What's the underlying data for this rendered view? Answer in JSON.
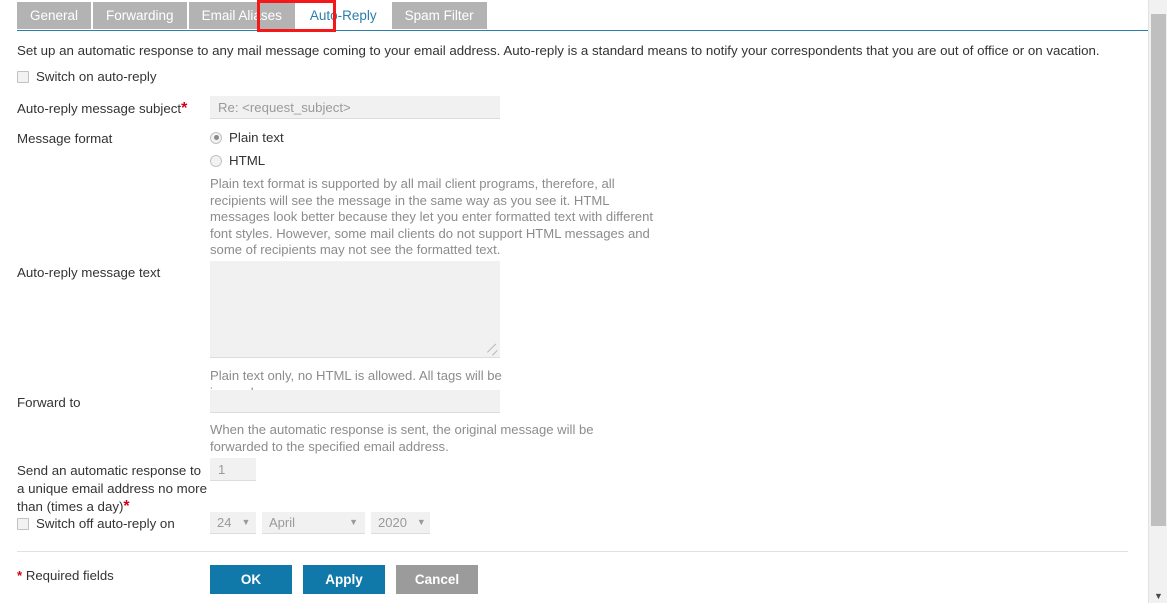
{
  "tabs": [
    {
      "label": "General",
      "active": false
    },
    {
      "label": "Forwarding",
      "active": false
    },
    {
      "label": "Email Aliases",
      "active": false
    },
    {
      "label": "Auto-Reply",
      "active": true
    },
    {
      "label": "Spam Filter",
      "active": false
    }
  ],
  "annotation": {
    "color": "#f51818",
    "target": "Auto-Reply"
  },
  "intro": "Set up an automatic response to any mail message coming to your email address. Auto-reply is a standard means to notify your correspondents that you are out of office or on vacation.",
  "switch_on": {
    "label": "Switch on auto-reply",
    "checked": false
  },
  "subject": {
    "label": "Auto-reply message subject",
    "required_marker": "*",
    "value": "",
    "placeholder": "Re: <request_subject>"
  },
  "message_format": {
    "label": "Message format",
    "options": [
      {
        "label": "Plain text",
        "selected": true
      },
      {
        "label": "HTML",
        "selected": false
      }
    ],
    "hint": "Plain text format is supported by all mail client programs, therefore, all recipients will see the message in the same way as you see it. HTML messages look better because they let you enter formatted text with different font styles. However, some mail clients do not support HTML messages and some of recipients may not see the formatted text."
  },
  "message_text": {
    "label": "Auto-reply message text",
    "value": "",
    "hint": "Plain text only, no HTML is allowed. All tags will be ignored."
  },
  "forward_to": {
    "label": "Forward to",
    "value": "",
    "hint": "When the automatic response is sent, the original message will be forwarded to the specified email address."
  },
  "response_limit": {
    "label": "Send an automatic response to a unique email address no more than (times a day)",
    "required_marker": "*",
    "value": "1"
  },
  "switch_off": {
    "label": "Switch off auto-reply on",
    "checked": false,
    "day": {
      "value": "24",
      "caret": "▼"
    },
    "month": {
      "value": "April",
      "caret": "▼"
    },
    "year": {
      "value": "2020",
      "caret": "▼"
    }
  },
  "footer": {
    "required_note_marker": "*",
    "required_note": "Required fields",
    "buttons": [
      {
        "label": "OK",
        "style": "primary",
        "color": "#1179aa"
      },
      {
        "label": "Apply",
        "style": "primary",
        "color": "#1179aa"
      },
      {
        "label": "Cancel",
        "style": "grey",
        "color": "#9b9b9b"
      }
    ]
  },
  "scrollbar": {
    "down_arrow": "▼"
  }
}
